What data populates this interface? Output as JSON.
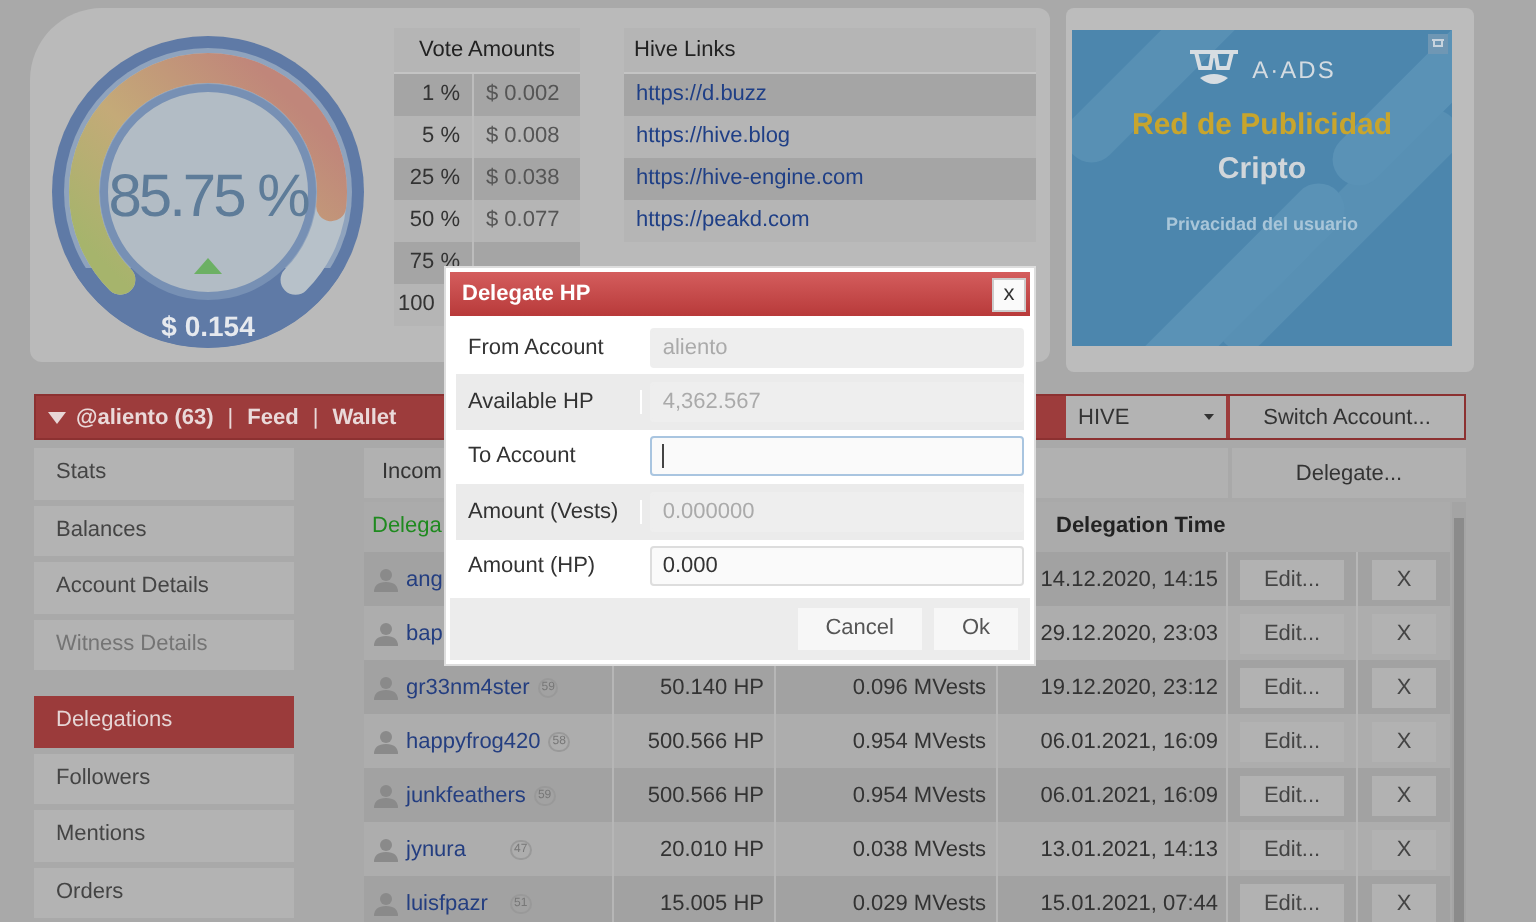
{
  "gauge": {
    "percent": "85.75 %",
    "value": "$ 0.154",
    "level": 0.8575
  },
  "vote_amounts": {
    "title": "Vote Amounts",
    "rows": [
      {
        "percent": "1 %",
        "amount": "$ 0.002"
      },
      {
        "percent": "5 %",
        "amount": "$ 0.008"
      },
      {
        "percent": "25 %",
        "amount": "$ 0.038"
      },
      {
        "percent": "50 %",
        "amount": "$ 0.077"
      },
      {
        "percent": "75 %"
      },
      {
        "percent": "100"
      }
    ]
  },
  "hive_links": {
    "title": "Hive Links",
    "links": [
      "https://d.buzz",
      "https://hive.blog",
      "https://hive-engine.com",
      "https://peakd.com"
    ]
  },
  "ad": {
    "brand": "A·ADS",
    "headline": "Red de Publicidad",
    "subline": "Cripto",
    "feature": "Privacidad del usuario"
  },
  "account_bar": {
    "items": [
      "@aliento (63)",
      "Feed",
      "Wallet"
    ],
    "separator": "|",
    "currency": "HIVE",
    "switch_button": "Switch Account..."
  },
  "sidebar": {
    "items": [
      {
        "label": "Stats",
        "selected": false,
        "disabled": false
      },
      {
        "label": "Balances",
        "selected": false,
        "disabled": false
      },
      {
        "label": "Account Details",
        "selected": false,
        "disabled": false
      },
      {
        "label": "Witness Details",
        "selected": false,
        "disabled": true
      },
      {
        "label": "Delegations",
        "selected": true,
        "disabled": false
      },
      {
        "label": "Followers",
        "selected": false,
        "disabled": false
      },
      {
        "label": "Mentions",
        "selected": false,
        "disabled": false
      },
      {
        "label": "Orders",
        "selected": false,
        "disabled": false
      }
    ]
  },
  "content": {
    "tab": "Incom",
    "delegate_button": "Delegate...",
    "table": {
      "columns": [
        "Delega",
        "Delegation Time"
      ],
      "rows": [
        {
          "account": "ang",
          "time": "14.12.2020, 14:15",
          "edit": "Edit...",
          "remove": "X"
        },
        {
          "account": "bap",
          "time": "29.12.2020, 23:03",
          "edit": "Edit...",
          "remove": "X"
        },
        {
          "account": "gr33nm4ster",
          "reputation": "59",
          "hp": "50.140 HP",
          "vests": "0.096 MVests",
          "time": "19.12.2020, 23:12",
          "edit": "Edit...",
          "remove": "X"
        },
        {
          "account": "happyfrog420",
          "reputation": "58",
          "hp": "500.566 HP",
          "vests": "0.954 MVests",
          "time": "06.01.2021, 16:09",
          "edit": "Edit...",
          "remove": "X"
        },
        {
          "account": "junkfeathers",
          "reputation": "59",
          "hp": "500.566 HP",
          "vests": "0.954 MVests",
          "time": "06.01.2021, 16:09",
          "edit": "Edit...",
          "remove": "X"
        },
        {
          "account": "jynura",
          "reputation": "47",
          "hp": "20.010 HP",
          "vests": "0.038 MVests",
          "time": "13.01.2021, 14:13",
          "edit": "Edit...",
          "remove": "X"
        },
        {
          "account": "luisfpazr",
          "reputation": "51",
          "hp": "15.005 HP",
          "vests": "0.029 MVests",
          "time": "15.01.2021, 07:44",
          "edit": "Edit...",
          "remove": "X"
        }
      ]
    }
  },
  "dialog": {
    "title": "Delegate HP",
    "close": "x",
    "fields": [
      {
        "label": "From Account",
        "value": "aliento",
        "disabled": true,
        "focused": false
      },
      {
        "label": "Available HP",
        "value": "4,362.567",
        "disabled": true,
        "focused": false
      },
      {
        "label": "To Account",
        "disabled": false,
        "focused": true
      },
      {
        "label": "Amount (Vests)",
        "value": "0.000000",
        "disabled": true,
        "focused": false
      },
      {
        "label": "Amount (HP)",
        "value": "0.000",
        "disabled": false,
        "focused": false
      }
    ],
    "buttons": [
      "Cancel",
      "Ok"
    ]
  }
}
